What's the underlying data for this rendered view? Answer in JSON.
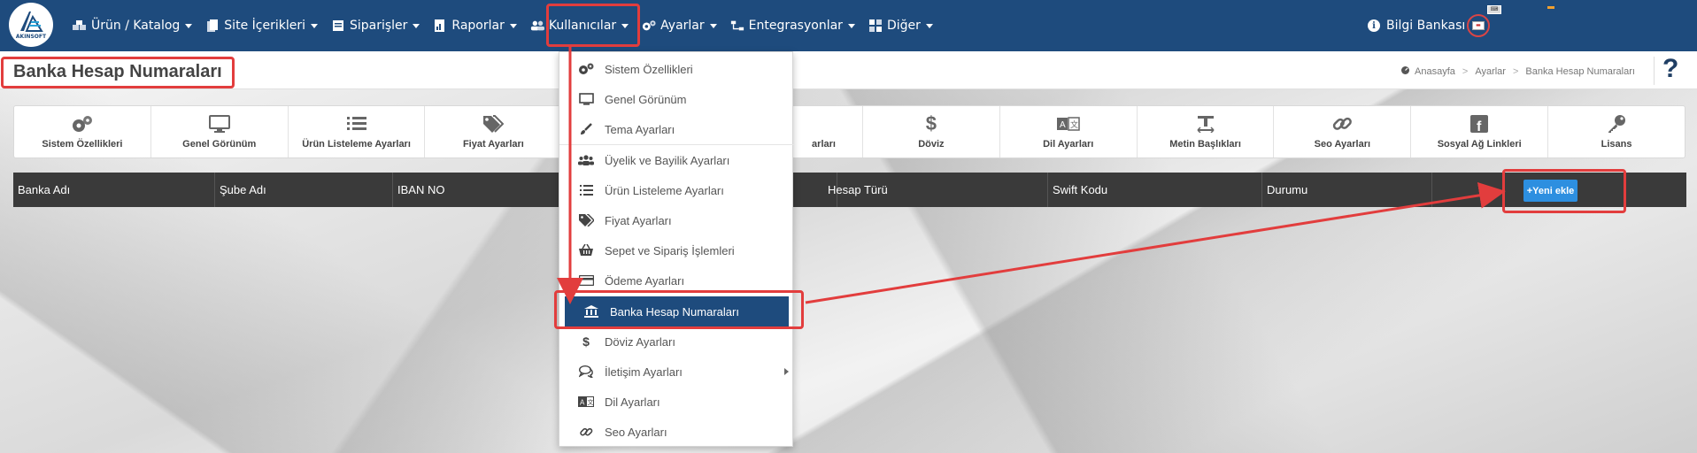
{
  "logo": {
    "text": "AKINSOFT"
  },
  "nav": {
    "items": [
      {
        "label": "Ürün / Katalog",
        "icon": "cubes-icon"
      },
      {
        "label": "Site İçerikleri",
        "icon": "file-icon"
      },
      {
        "label": "Siparişler",
        "icon": "cart-icon"
      },
      {
        "label": "Raporlar",
        "icon": "report-icon"
      },
      {
        "label": "Kullanıcılar",
        "icon": "users-icon"
      },
      {
        "label": "Ayarlar",
        "icon": "cogs-icon"
      },
      {
        "label": "Entegrasyonlar",
        "icon": "sitemap-icon"
      },
      {
        "label": "Diğer",
        "icon": "grid-icon"
      }
    ],
    "right_label": "Bilgi Bankası"
  },
  "header": {
    "title": "Banka Hesap Numaraları",
    "breadcrumb": [
      "Anasayfa",
      "Ayarlar",
      "Banka Hesap Numaraları"
    ],
    "help": "?"
  },
  "settings_bar": [
    {
      "label": "Sistem Özellikleri",
      "icon": "cogs-icon"
    },
    {
      "label": "Genel Görünüm",
      "icon": "monitor-icon"
    },
    {
      "label": "Ürün Listeleme Ayarları",
      "icon": "list-icon"
    },
    {
      "label": "Fiyat Ayarları",
      "icon": "tags-icon"
    },
    {
      "label": "",
      "icon": ""
    },
    {
      "label": "arları",
      "icon": ""
    },
    {
      "label": "Döviz",
      "icon": "dollar-icon"
    },
    {
      "label": "Dil Ayarları",
      "icon": "language-icon"
    },
    {
      "label": "Metin Başlıkları",
      "icon": "text-height-icon"
    },
    {
      "label": "Seo Ayarları",
      "icon": "link-icon"
    },
    {
      "label": "Sosyal Ağ Linkleri",
      "icon": "facebook-icon"
    },
    {
      "label": "Lisans",
      "icon": "key-icon"
    }
  ],
  "table": {
    "columns": [
      "Banka Adı",
      "Şube Adı",
      "IBAN NO",
      "",
      "Hesap Türü",
      "Swift Kodu",
      "Durumu",
      ""
    ],
    "new_button": "+Yeni ekle"
  },
  "dropdown": {
    "items": [
      {
        "label": "Sistem Özellikleri",
        "icon": "cogs-icon"
      },
      {
        "label": "Genel Görünüm",
        "icon": "monitor-icon"
      },
      {
        "label": "Tema Ayarları",
        "icon": "brush-icon"
      },
      {
        "label": "Üyelik ve Bayilik Ayarları",
        "icon": "users-icon"
      },
      {
        "label": "Ürün Listeleme Ayarları",
        "icon": "list-icon"
      },
      {
        "label": "Fiyat Ayarları",
        "icon": "tags-icon"
      },
      {
        "label": "Sepet ve Sipariş İşlemleri",
        "icon": "basket-icon"
      },
      {
        "label": "Ödeme Ayarları",
        "icon": "credit-card-icon"
      },
      {
        "label": "Banka Hesap Numaraları",
        "icon": "bank-icon"
      },
      {
        "label": "Döviz Ayarları",
        "icon": "dollar-icon"
      },
      {
        "label": "İletişim Ayarları",
        "icon": "comments-icon"
      },
      {
        "label": "Dil Ayarları",
        "icon": "language-icon"
      },
      {
        "label": "Seo Ayarları",
        "icon": "link-icon"
      }
    ]
  },
  "colors": {
    "nav_bg": "#1e4b7d",
    "selected_bg": "#1e4b7d",
    "button_bg": "#2d8fe0",
    "annotation_red": "#e23d3d",
    "table_header_bg": "#3a3a3a"
  }
}
